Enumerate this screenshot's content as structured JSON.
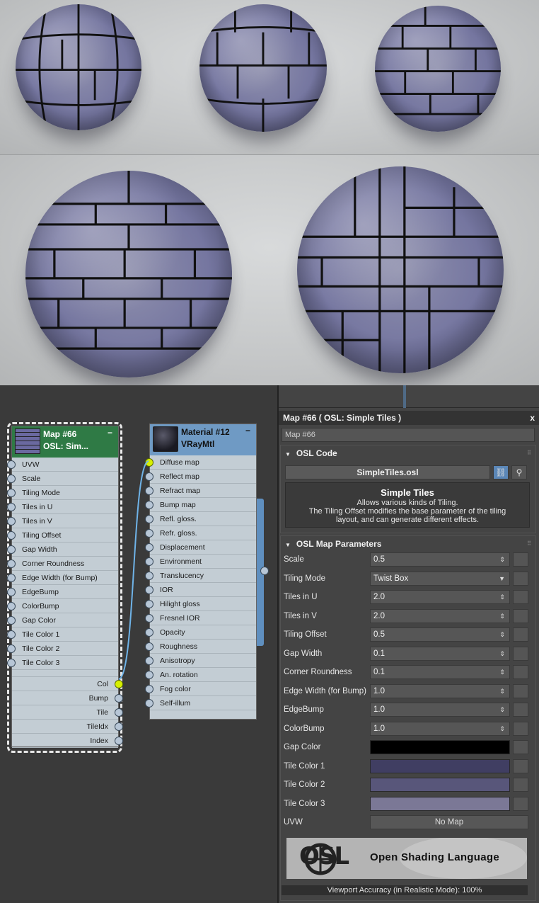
{
  "map_node": {
    "title": "Map #66",
    "subtitle": "OSL: Sim...",
    "minimize": "−",
    "inputs": [
      "UVW",
      "Scale",
      "Tiling Mode",
      "Tiles in U",
      "Tiles in V",
      "Tiling Offset",
      "Gap Width",
      "Corner Roundness",
      "Edge Width (for Bump)",
      "EdgeBump",
      "ColorBump",
      "Gap Color",
      "Tile Color 1",
      "Tile Color 2",
      "Tile Color 3"
    ],
    "outputs": [
      "Col",
      "Bump",
      "Tile",
      "TileIdx",
      "Index"
    ]
  },
  "material_node": {
    "title": "Material #12",
    "subtitle": "VRayMtl",
    "minimize": "−",
    "inputs": [
      "Diffuse map",
      "Reflect map",
      "Refract map",
      "Bump map",
      "Refl. gloss.",
      "Refr. gloss.",
      "Displacement",
      "Environment",
      "Translucency",
      "IOR",
      "Hilight gloss",
      "Fresnel IOR",
      "Opacity",
      "Roughness",
      "Anisotropy",
      "An. rotation",
      "Fog color",
      "Self-illum"
    ]
  },
  "panel": {
    "title": "Map #66  ( OSL: Simple Tiles )",
    "close": "x",
    "name_value": "Map #66",
    "osl_code": {
      "header": "OSL Code",
      "file": "SimpleTiles.osl",
      "desc_title": "Simple Tiles",
      "desc_line1": "Allows various kinds of Tiling.",
      "desc_line2": "The Tiling Offset modifies the base parameter of the tiling",
      "desc_line3": "layout, and can generate different effects."
    },
    "params_header": "OSL Map Parameters",
    "params": [
      {
        "label": "Scale",
        "value": "0.5",
        "kind": "spin"
      },
      {
        "label": "Tiling Mode",
        "value": "Twist Box",
        "kind": "drop"
      },
      {
        "label": "Tiles in U",
        "value": "2.0",
        "kind": "spin"
      },
      {
        "label": "Tiles in V",
        "value": "2.0",
        "kind": "spin"
      },
      {
        "label": "Tiling Offset",
        "value": "0.5",
        "kind": "spin"
      },
      {
        "label": "Gap Width",
        "value": "0.1",
        "kind": "spin"
      },
      {
        "label": "Corner Roundness",
        "value": "0.1",
        "kind": "spin"
      },
      {
        "label": "Edge Width (for Bump)",
        "value": "1.0",
        "kind": "spin"
      },
      {
        "label": "EdgeBump",
        "value": "1.0",
        "kind": "spin"
      },
      {
        "label": "ColorBump",
        "value": "1.0",
        "kind": "spin"
      }
    ],
    "colors": [
      {
        "label": "Gap Color",
        "hex": "#000000"
      },
      {
        "label": "Tile Color 1",
        "hex": "#403e62"
      },
      {
        "label": "Tile Color 2",
        "hex": "#58567a"
      },
      {
        "label": "Tile Color 3",
        "hex": "#7b7896"
      }
    ],
    "uvw_label": "UVW",
    "uvw_value": "No Map",
    "logo_text": "Open Shading Language",
    "logo_mark": "OSL",
    "status": "Viewport Accuracy (in Realistic Mode): 100%"
  },
  "colors": {
    "node_map_header": "#2f7a45",
    "node_mat_header": "#6f9ac4",
    "active_pin": "#d7f000",
    "wire": "#6fb3e8"
  }
}
